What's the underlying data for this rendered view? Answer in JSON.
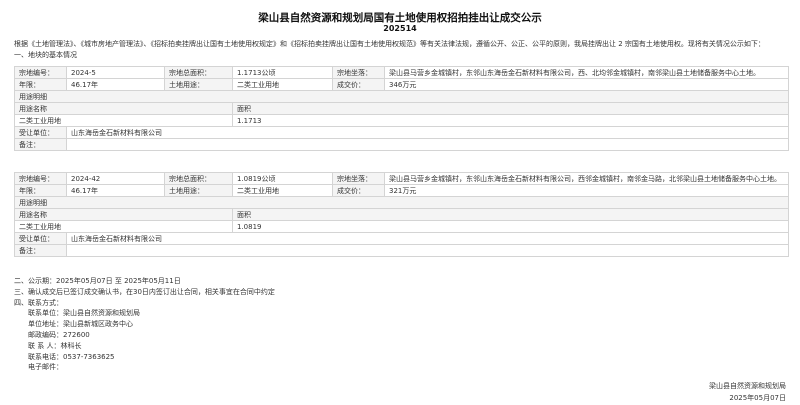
{
  "title": "梁山县自然资源和规划局国有土地使用权招拍挂出让成交公示",
  "subtitle": "202514",
  "intro": {
    "line1": "    根据《土地管理法》、《城市房地产管理法》、《招标拍卖挂牌出让国有土地使用权规定》和《招标拍卖挂牌出让国有土地使用权规范》等有关法律法规，遵循公开、公正、公平的原则，我局挂牌出让 2 宗国有土地使用权。现将有关情况公示如下：",
    "line2": "一、地块的基本情况"
  },
  "labels": {
    "parcel_no": "宗地编号：",
    "area": "宗地总面积：",
    "location": "宗地坐落：",
    "term": "年限：",
    "use": "土地用途：",
    "price": "成交价：",
    "use_details": "用途明细",
    "use_name": "用途名称",
    "sub_area": "面积",
    "winner": "受让单位：",
    "remark": "备注："
  },
  "parcels": [
    {
      "parcel_no": "2024-5",
      "area": "1.1713公顷",
      "location": "梁山县马营乡金城镇村，东邻山东海岳金石新材料有限公司，西、北均邻金城镇村，南邻梁山县土地储备服务中心土地。",
      "term": "46.17年",
      "use": "二类工业用地",
      "price": "346万元",
      "use_name": "二类工业用地",
      "sub_area": "1.1713",
      "winner": "山东海岳金石新材料有限公司",
      "remark": ""
    },
    {
      "parcel_no": "2024-42",
      "area": "1.0819公顷",
      "location": "梁山县马营乡金城镇村，东邻山东海岳金石新材料有限公司，西邻金城镇村，南邻金马路，北邻梁山县土地储备服务中心土地。",
      "term": "46.17年",
      "use": "二类工业用地",
      "price": "321万元",
      "use_name": "二类工业用地",
      "sub_area": "1.0819",
      "winner": "山东海岳金石新材料有限公司",
      "remark": ""
    }
  ],
  "footer": {
    "period": "二、公示期：2025年05月07日 至 2025年05月11日",
    "contract": "三、确认成交后已签订成交确认书，在30日内签订出让合同，相关事宜在合同中约定",
    "contact_title": "四、联系方式：",
    "unit": "联系单位：梁山县自然资源和规划局",
    "address": "单位地址：梁山县新城区政务中心",
    "postcode": "邮政编码：272600",
    "person": "联 系 人：林科长",
    "phone": "联系电话：0537-7363625",
    "email": "电子邮件："
  },
  "signature": {
    "org": "梁山县自然资源和规划局",
    "date": "2025年05月07日"
  }
}
